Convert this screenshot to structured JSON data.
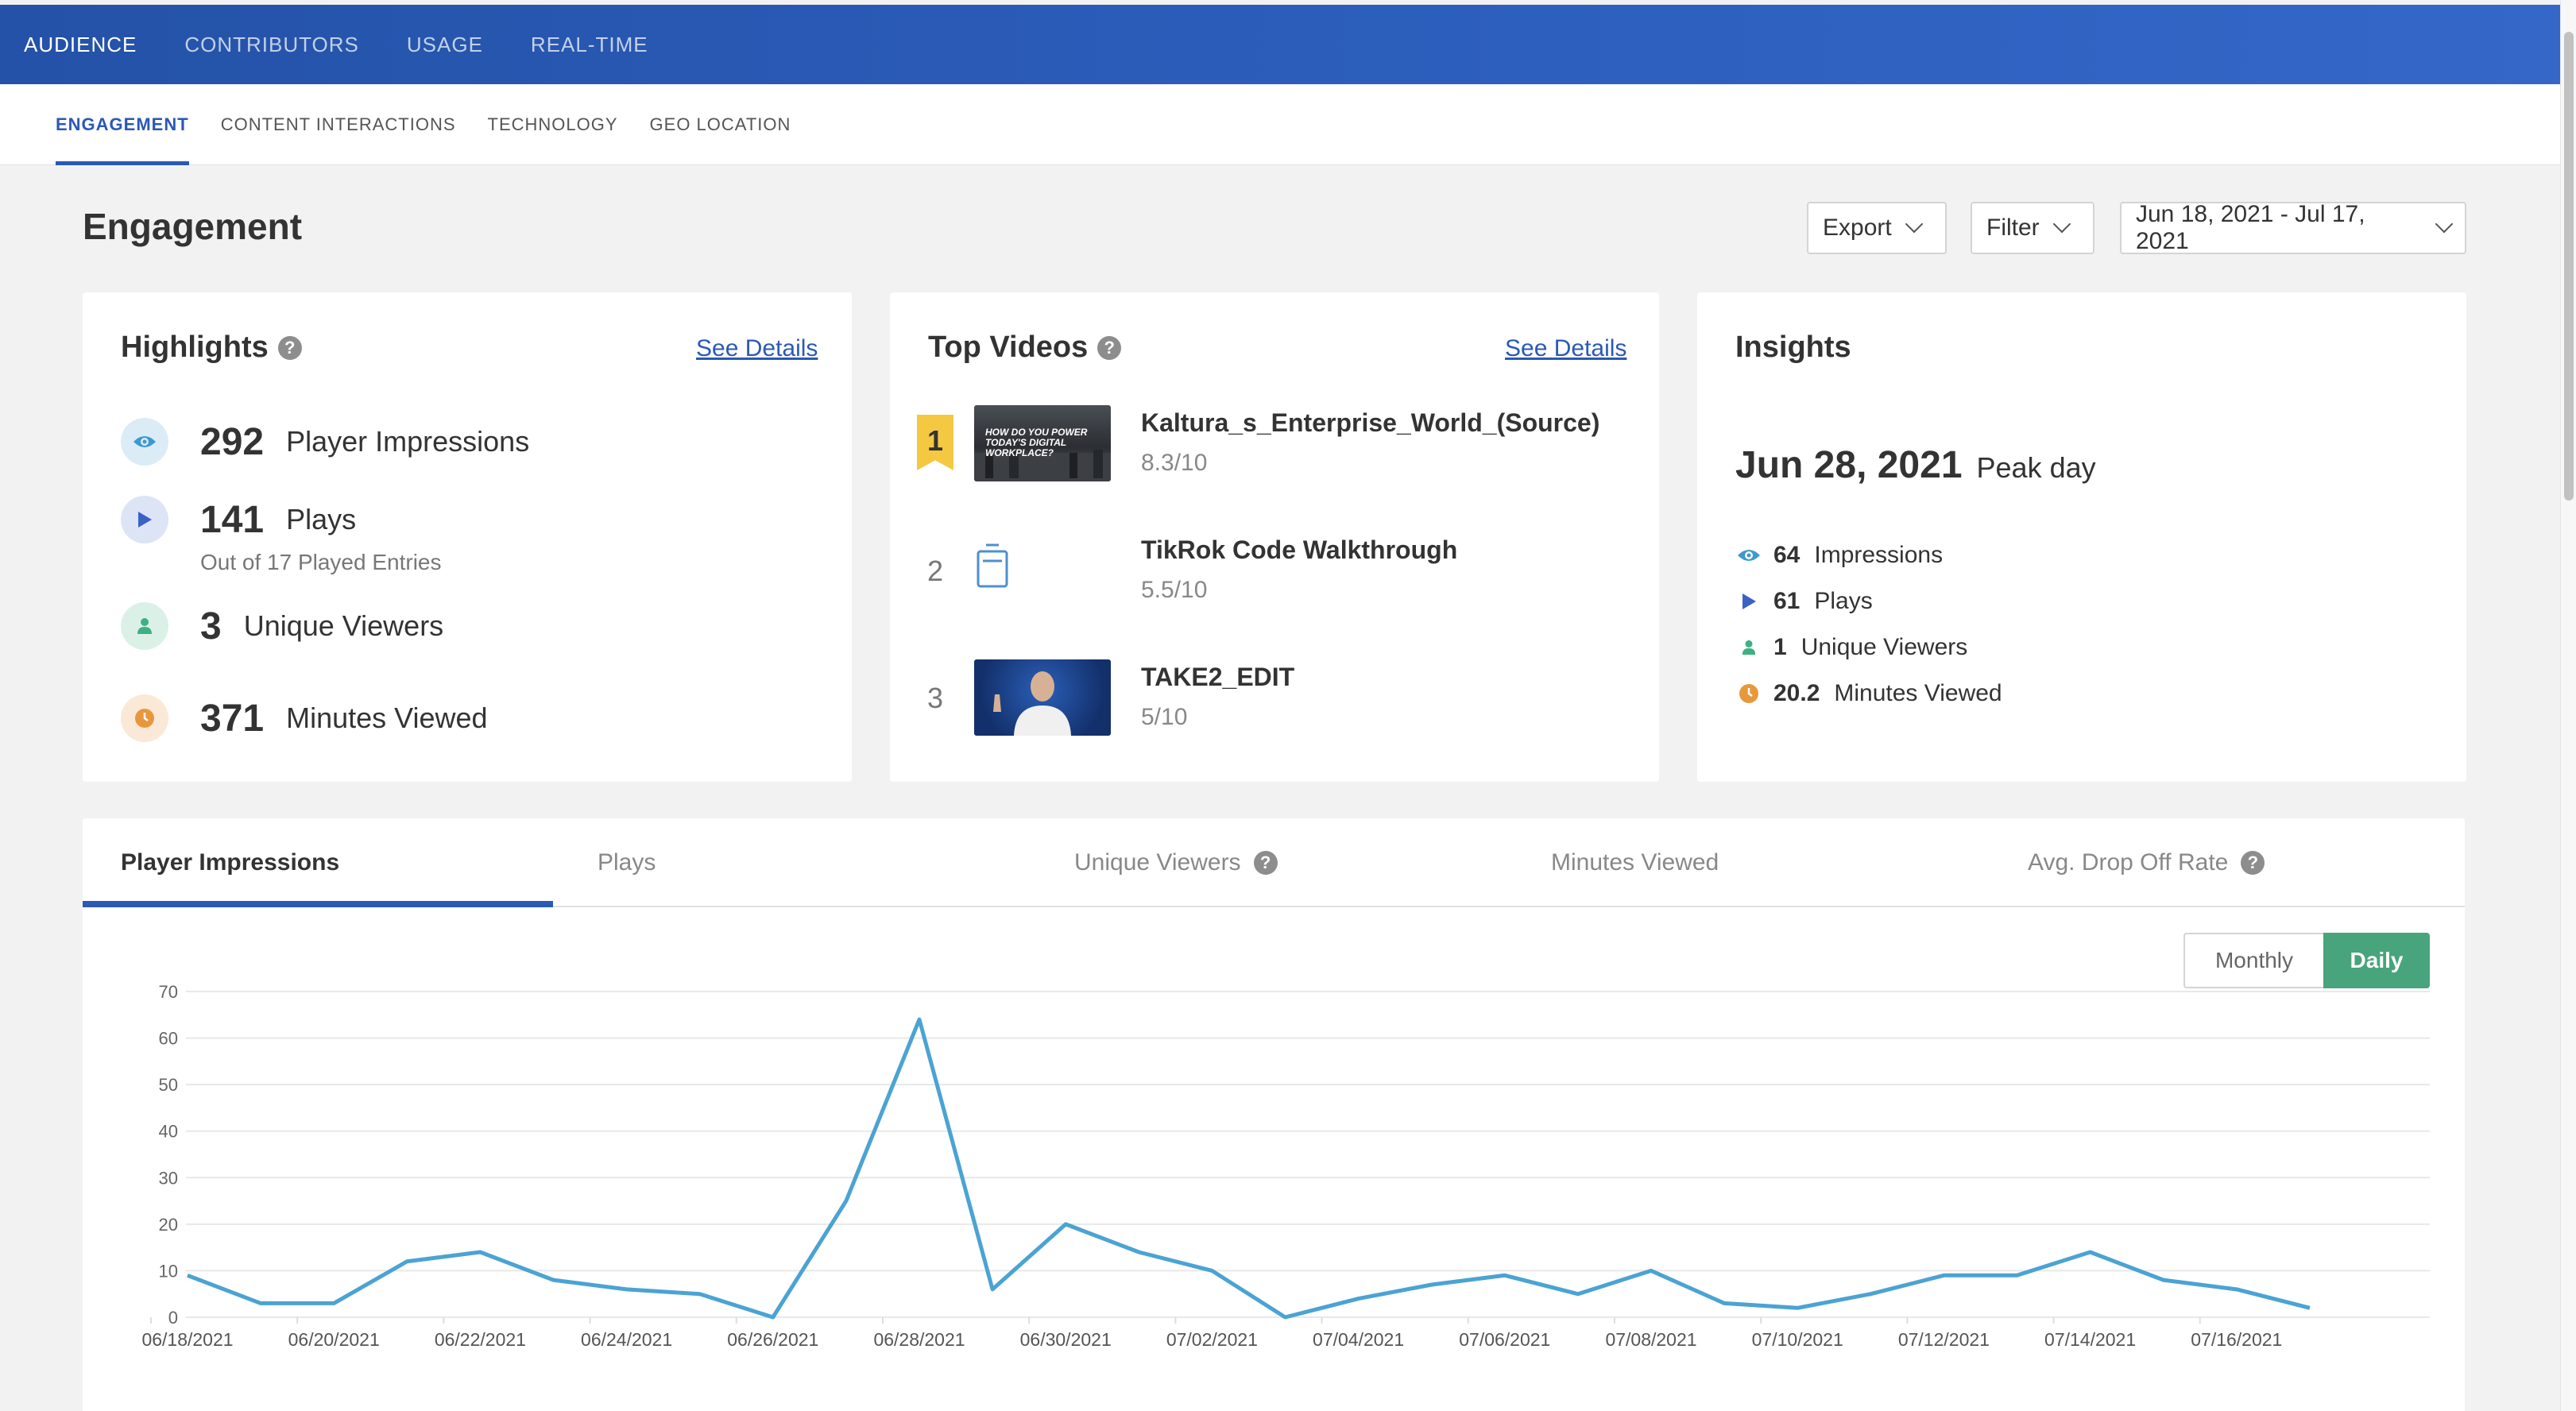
{
  "topnav": {
    "tabs": [
      "AUDIENCE",
      "CONTRIBUTORS",
      "USAGE",
      "REAL-TIME"
    ]
  },
  "subnav": {
    "tabs": [
      "ENGAGEMENT",
      "CONTENT INTERACTIONS",
      "TECHNOLOGY",
      "GEO LOCATION"
    ]
  },
  "page": {
    "title": "Engagement",
    "export_label": "Export",
    "filter_label": "Filter",
    "date_range": "Jun 18, 2021 - Jul 17, 2021"
  },
  "highlights": {
    "title": "Highlights",
    "help": "?",
    "see_details": "See Details",
    "impressions": {
      "value": "292",
      "label": "Player Impressions"
    },
    "plays": {
      "value": "141",
      "label": "Plays",
      "sub": "Out of 17 Played Entries"
    },
    "viewers": {
      "value": "3",
      "label": "Unique Viewers"
    },
    "minutes": {
      "value": "371",
      "label": "Minutes Viewed"
    }
  },
  "top_videos": {
    "title": "Top Videos",
    "help": "?",
    "see_details": "See Details",
    "items": [
      {
        "rank": "1",
        "name": "Kaltura_s_Enterprise_World_(Source)",
        "score": "8.3/10",
        "thumb_text": "HOW DO YOU POWER TODAY'S DIGITAL WORKPLACE?"
      },
      {
        "rank": "2",
        "name": "TikRok Code Walkthrough",
        "score": "5.5/10"
      },
      {
        "rank": "3",
        "name": "TAKE2_EDIT",
        "score": "5/10"
      }
    ]
  },
  "insights": {
    "title": "Insights",
    "peak_date": "Jun 28, 2021",
    "peak_label": "Peak day",
    "impressions": {
      "value": "64",
      "label": "Impressions"
    },
    "plays": {
      "value": "61",
      "label": "Plays"
    },
    "viewers": {
      "value": "1",
      "label": "Unique Viewers"
    },
    "minutes": {
      "value": "20.2",
      "label": "Minutes Viewed"
    }
  },
  "chart_tabs": [
    "Player Impressions",
    "Plays",
    "Unique Viewers",
    "Minutes Viewed",
    "Avg. Drop Off Rate"
  ],
  "chart_tab_help": "?",
  "granularity": {
    "monthly": "Monthly",
    "daily": "Daily",
    "selected": "Daily"
  },
  "colors": {
    "brand_blue": "#2a59b6",
    "line": "#4ba3d3",
    "daily_green": "#47a47c",
    "badge_gold": "#f5c842"
  },
  "chart_data": {
    "type": "line",
    "title": "",
    "series": [
      {
        "values": [
          9,
          3,
          3,
          12,
          14,
          8,
          6,
          5,
          0,
          25,
          64,
          6,
          20,
          14,
          10,
          0,
          4,
          7,
          9,
          5,
          10,
          3,
          2,
          5,
          9,
          9,
          14,
          8,
          6,
          2
        ]
      }
    ],
    "x": [
      "06/18/2021",
      "06/19/2021",
      "06/20/2021",
      "06/21/2021",
      "06/22/2021",
      "06/23/2021",
      "06/24/2021",
      "06/25/2021",
      "06/26/2021",
      "06/27/2021",
      "06/28/2021",
      "06/29/2021",
      "06/30/2021",
      "07/01/2021",
      "07/02/2021",
      "07/03/2021",
      "07/04/2021",
      "07/05/2021",
      "07/06/2021",
      "07/07/2021",
      "07/08/2021",
      "07/09/2021",
      "07/10/2021",
      "07/11/2021",
      "07/12/2021",
      "07/13/2021",
      "07/14/2021",
      "07/15/2021",
      "07/16/2021",
      "07/17/2021"
    ],
    "x_tick_labels": [
      "06/18/2021",
      "06/20/2021",
      "06/22/2021",
      "06/24/2021",
      "06/26/2021",
      "06/28/2021",
      "06/30/2021",
      "07/02/2021",
      "07/04/2021",
      "07/06/2021",
      "07/08/2021",
      "07/10/2021",
      "07/12/2021",
      "07/14/2021",
      "07/16/2021"
    ],
    "y_ticks": [
      0,
      10,
      20,
      30,
      40,
      50,
      60,
      70
    ],
    "ylim": [
      0,
      70
    ],
    "grid": true,
    "legend": "none"
  }
}
